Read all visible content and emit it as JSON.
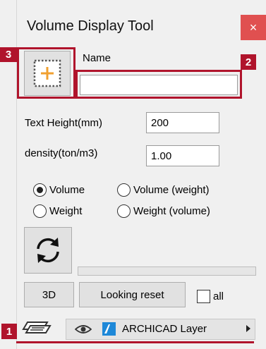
{
  "window": {
    "title": "Volume Display Tool",
    "close_glyph": "×"
  },
  "name_field": {
    "label": "Name",
    "value": ""
  },
  "text_height": {
    "label": "Text Height(mm)",
    "value": "200"
  },
  "density": {
    "label": "density(ton/m3)",
    "value": "1.00"
  },
  "display_mode": {
    "options": [
      "Volume",
      "Volume (weight)",
      "Weight",
      "Weight (volume)"
    ],
    "selected": "Volume"
  },
  "buttons": {
    "three_d": "3D",
    "looking_reset": "Looking reset",
    "all_label": "all"
  },
  "progress": {
    "value": 0
  },
  "layer_bar": {
    "layer_name": "ARCHICAD Layer"
  },
  "callouts": {
    "badge_1": "1",
    "badge_2": "2",
    "badge_3": "3"
  },
  "icons": {
    "add": "add-element-icon",
    "refresh": "refresh-icon",
    "layer": "layers-icon",
    "visibility": "eye-icon",
    "archicad": "archicad-icon",
    "menu": "triangle-right-icon"
  },
  "colors": {
    "callout": "#b0142c",
    "close": "#e05050",
    "add_icon": "#f0a030",
    "archicad_icon": "#1e88d8"
  }
}
